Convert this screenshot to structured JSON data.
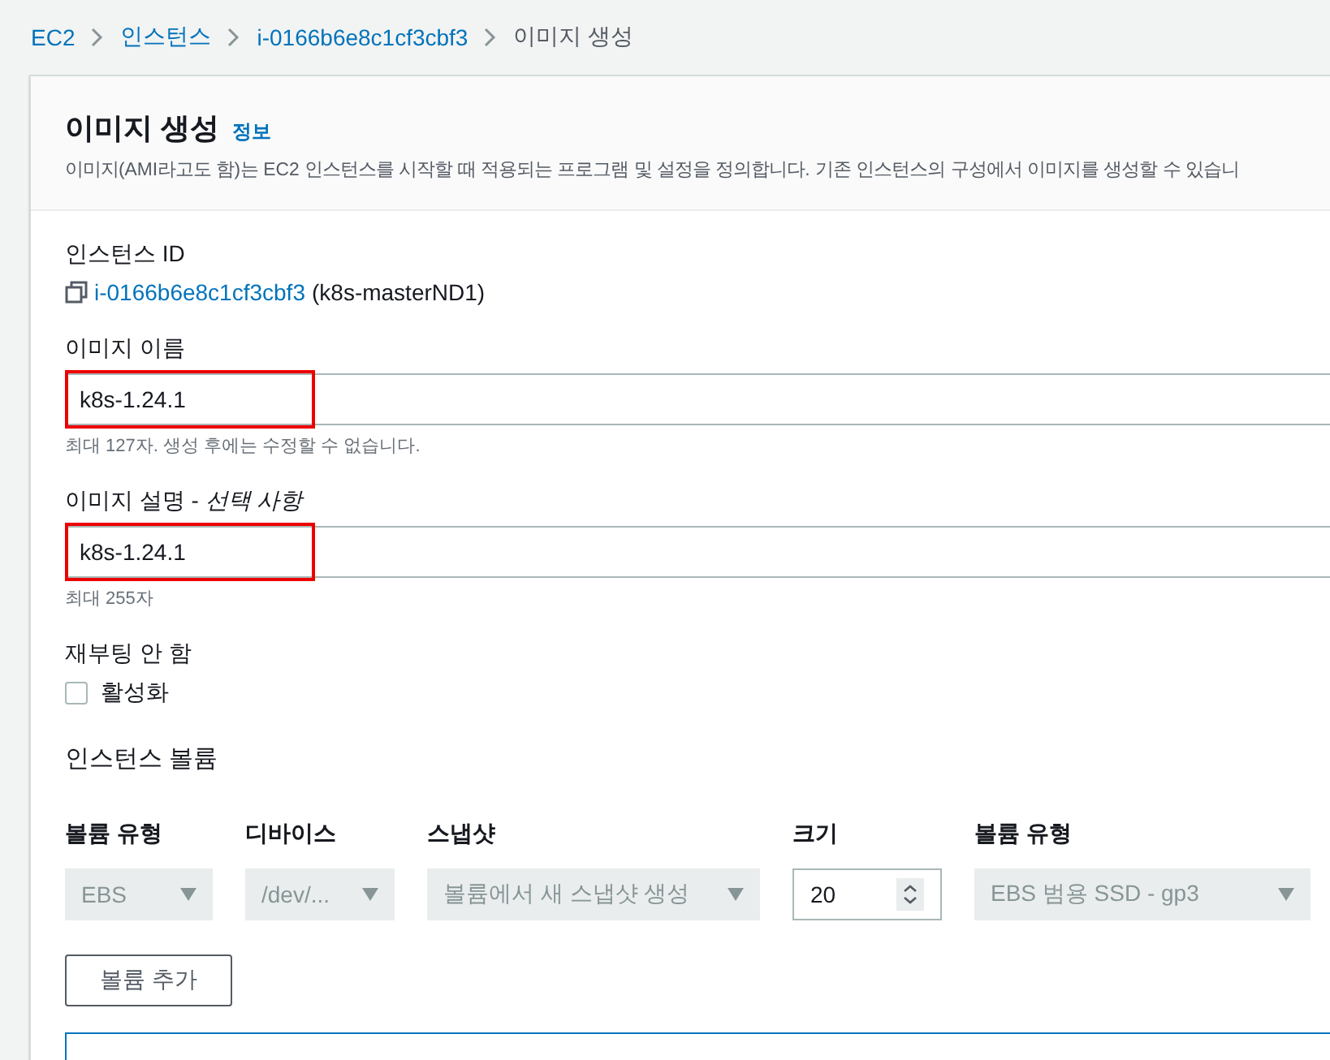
{
  "breadcrumb": [
    {
      "label": "EC2",
      "link": true
    },
    {
      "label": "인스턴스",
      "link": true
    },
    {
      "label": "i-0166b6e8c1cf3cbf3",
      "link": true
    },
    {
      "label": "이미지 생성",
      "link": false
    }
  ],
  "header": {
    "title": "이미지 생성",
    "info_link": "정보",
    "description": "이미지(AMI라고도 함)는 EC2 인스턴스를 시작할 때 적용되는 프로그램 및 설정을 정의합니다. 기존 인스턴스의 구성에서 이미지를 생성할 수 있습니"
  },
  "instance": {
    "label": "인스턴스 ID",
    "id": "i-0166b6e8c1cf3cbf3",
    "name": "(k8s-masterND1)"
  },
  "fields": [
    {
      "label": "이미지 이름",
      "value": "k8s-1.24.1",
      "hint": "최대 127자. 생성 후에는 수정할 수 없습니다.",
      "highlighted": true
    },
    {
      "label": "이미지 설명 -",
      "label_optional": "선택 사항",
      "value": "k8s-1.24.1",
      "hint": "최대 255자",
      "highlighted": true
    }
  ],
  "no_reboot": {
    "label": "재부팅 안 함",
    "option": "활성화",
    "checked": false
  },
  "volumes": {
    "title": "인스턴스 볼륨",
    "columns": [
      "볼륨 유형",
      "디바이스",
      "스냅샷",
      "크기",
      "볼륨 유형"
    ],
    "row": [
      {
        "kind": "select",
        "value": "EBS",
        "disabled": true
      },
      {
        "kind": "select",
        "value": "/dev/...",
        "disabled": true
      },
      {
        "kind": "select",
        "value": "볼륨에서 새 스냅샷 생성",
        "disabled": true
      },
      {
        "kind": "number",
        "value": "20",
        "disabled": false
      },
      {
        "kind": "select",
        "value": "EBS 범용 SSD - gp3",
        "disabled": true
      }
    ],
    "add_button": "볼륨 추가"
  }
}
